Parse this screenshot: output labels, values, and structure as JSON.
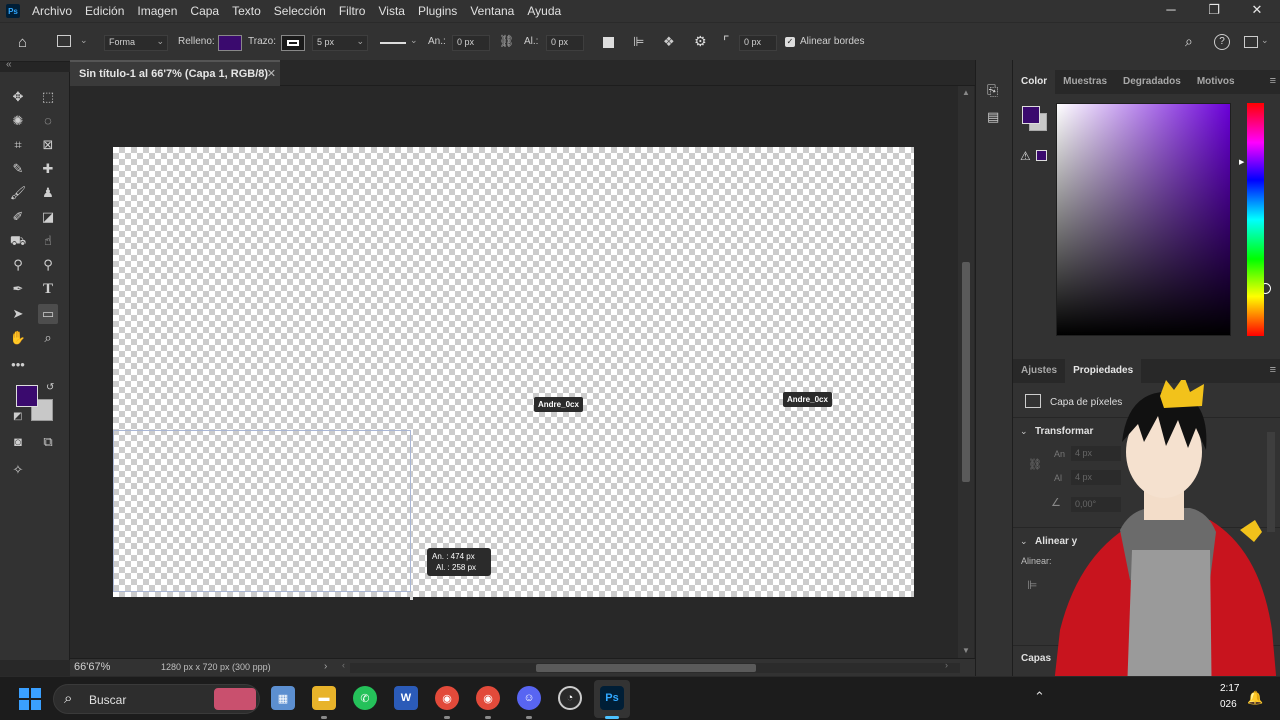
{
  "app": {
    "logo": "Ps"
  },
  "menu": [
    "Archivo",
    "Edición",
    "Imagen",
    "Capa",
    "Texto",
    "Selección",
    "Filtro",
    "Vista",
    "Plugins",
    "Ventana",
    "Ayuda"
  ],
  "window_controls": {
    "minimize": "─",
    "maximize": "❐",
    "close": "✕"
  },
  "options": {
    "shape_mode": "Forma",
    "fill_label": "Relleno:",
    "fill_color": "#3a0a6e",
    "stroke_label": "Trazo:",
    "stroke_width": "5 px",
    "width_label": "An.:",
    "width_value": "0 px",
    "height_label": "Al.:",
    "height_value": "0 px",
    "corner_radius": "0 px",
    "align_edges_label": "Alinear bordes"
  },
  "document": {
    "tab_title": "Sin título-1 al 66'7% (Capa 1, RGB/8)",
    "zoom": "66'67%",
    "info": "1280 px x 720 px (300 ppp)"
  },
  "canvas": {
    "watermark": "Andre_0cx",
    "tooltip_width": "An. :  474 px",
    "tooltip_height": "Al. :  258 px"
  },
  "colors": {
    "foreground": "#3a0a6e",
    "background": "#c8c8c8"
  },
  "color_panel": {
    "tabs": [
      "Color",
      "Muestras",
      "Degradados",
      "Motivos"
    ]
  },
  "properties_panel": {
    "tabs": [
      "Ajustes",
      "Propiedades"
    ],
    "layer_type": "Capa de píxeles",
    "transform_section": "Transformar",
    "w_label": "An",
    "w_value": "4 px",
    "h_label": "Al",
    "h_value": "4 px",
    "angle_value": "0,00°",
    "align_section": "Alinear y",
    "align_label": "Alinear:",
    "layers_section": "Capas"
  },
  "taskbar": {
    "search_placeholder": "Buscar",
    "clock_time": "2:17",
    "clock_date": "026"
  }
}
